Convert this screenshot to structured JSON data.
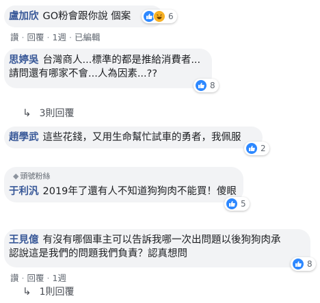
{
  "comments": [
    {
      "name": "盧加欣",
      "text": [
        "GO粉會跟你說 個案"
      ],
      "reactions": "6",
      "actions": {
        "like": "讚",
        "reply": "回覆",
        "time": "1週",
        "edited": "已編輯"
      }
    },
    {
      "name": "思婷吳",
      "text": [
        "台灣商人...標準的都是推給消費者...",
        "請問還有哪家不會...人為因素...??"
      ],
      "reactions": "8",
      "reply_toggle": "3則回覆"
    },
    {
      "name": "趙學武",
      "text": [
        "這些花錢，又用生命幫忙試車的勇者，我佩服"
      ],
      "reactions": "2"
    },
    {
      "badge": "頭號粉絲",
      "name": "于利汎",
      "text": [
        "2019年了還有人不知道狗狗肉不能買！傻眼"
      ],
      "reactions": "5"
    },
    {
      "name": "王見億",
      "text": [
        "有沒有哪個車主可以告訴我哪一次出問題以後狗狗肉承",
        "認說這是我們的問題我們負責？認真想問"
      ],
      "reactions": "8",
      "actions": {
        "like": "讚",
        "reply": "回覆",
        "time": "1週"
      },
      "reply_toggle": "1則回覆"
    }
  ]
}
